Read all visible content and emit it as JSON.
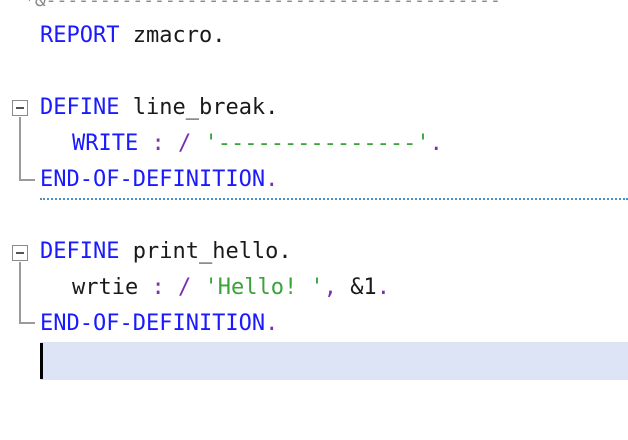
{
  "top_comment": "*&------------------------------------------",
  "lines": {
    "report": {
      "kw": "REPORT",
      "rest": " zmacro."
    },
    "define1": {
      "kw": "DEFINE",
      "rest": " line_break."
    },
    "write": {
      "kw": "WRITE",
      "sep": " : / ",
      "str": "'---------------'",
      "end": "."
    },
    "end1": {
      "kw": "END-OF-DEFINITION",
      "end": "."
    },
    "define2": {
      "kw": "DEFINE",
      "rest": " print_hello."
    },
    "wrtie": {
      "plain": "wrtie",
      "sep": " : / ",
      "str": "'Hello! '",
      "comma": ", ",
      "arg": "&1",
      "end": "."
    },
    "end2": {
      "kw": "END-OF-DEFINITION",
      "end": "."
    }
  },
  "colors": {
    "keyword": "#1a1aff",
    "string": "#3aa33a",
    "current_line": "#dde4f5",
    "separator": "#4a90c8"
  },
  "icons": {
    "fold": "collapse-minus-icon"
  }
}
